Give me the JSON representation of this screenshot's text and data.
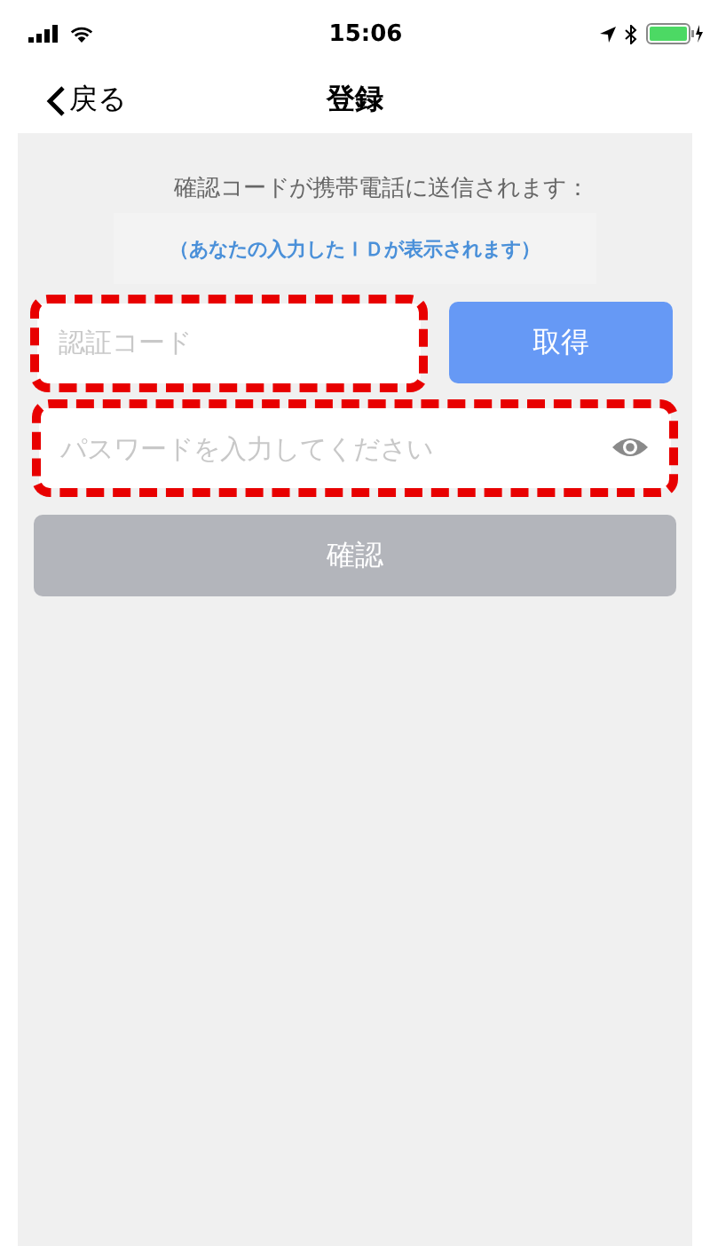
{
  "status_bar": {
    "time": "15:06"
  },
  "nav": {
    "back": "戻る",
    "title": "登録"
  },
  "notice": "確認コードが携帯電話に送信されます：",
  "id_hint": "（あなたの入力したＩＤが表示されます）",
  "code_field": {
    "placeholder": "認証コード",
    "highlighted": true
  },
  "get_button": {
    "label": "取得"
  },
  "password_field": {
    "placeholder": "パスワードを入力してください",
    "highlighted": true
  },
  "confirm_button": {
    "label": "確認",
    "disabled": true
  }
}
